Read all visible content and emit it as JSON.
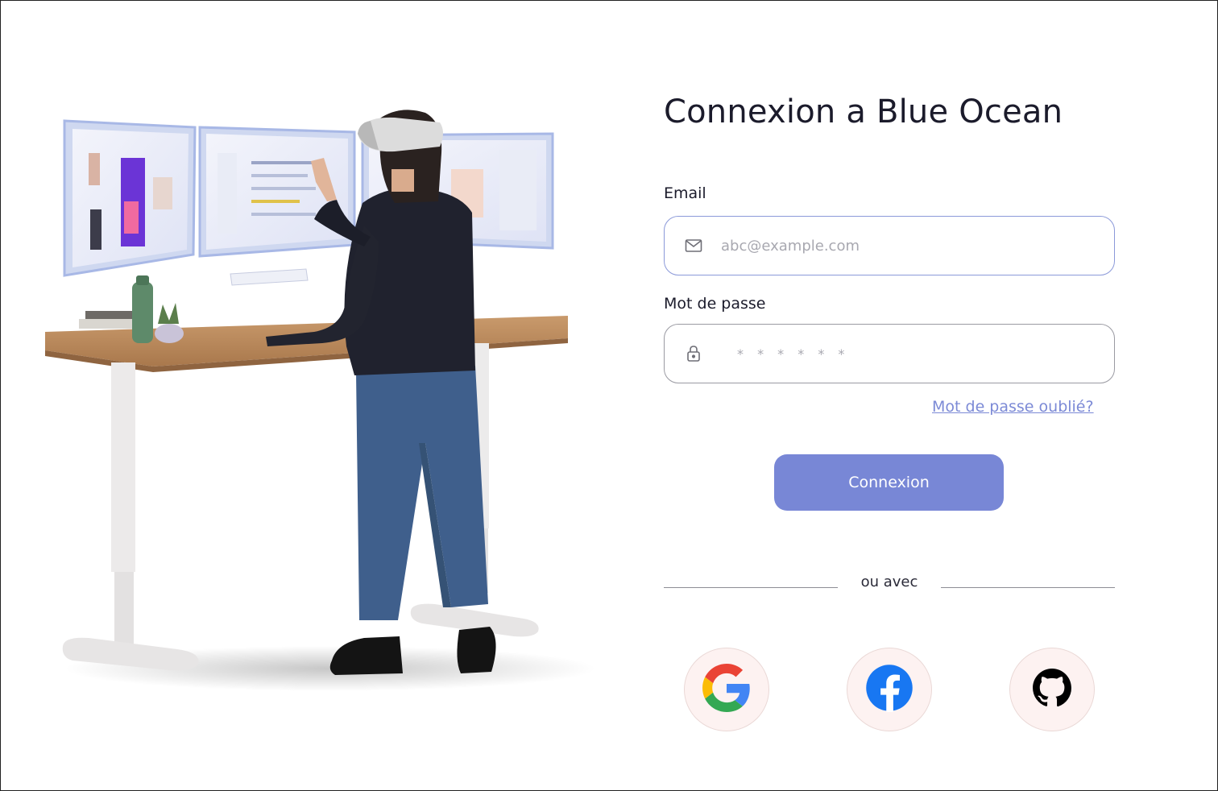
{
  "form": {
    "title": "Connexion a Blue Ocean",
    "email_label": "Email",
    "email_placeholder": "abc@example.com",
    "password_label": "Mot de passe",
    "password_placeholder": "* * * * * *",
    "forgot_link": "Mot de passe oublié?",
    "submit_label": "Connexion",
    "divider_text": "ou avec"
  },
  "social": [
    {
      "name": "google",
      "icon": "google-icon"
    },
    {
      "name": "facebook",
      "icon": "facebook-icon"
    },
    {
      "name": "github",
      "icon": "github-icon"
    }
  ],
  "colors": {
    "accent": "#7887d6",
    "link": "#7c8ad6",
    "social_bg": "#fdf2f1"
  }
}
